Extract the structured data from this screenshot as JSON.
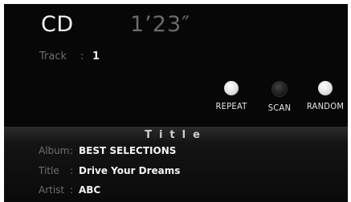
{
  "header": {
    "source": "CD",
    "time": "1’23″"
  },
  "track": {
    "label": "Track",
    "separator": ":",
    "value": "1"
  },
  "modes": [
    {
      "label": "REPEAT",
      "active": false
    },
    {
      "label": "SCAN",
      "active": true
    },
    {
      "label": "RANDOM",
      "active": false
    }
  ],
  "info": {
    "heading": "Title",
    "rows": [
      {
        "label": "Album",
        "separator": ":",
        "value": "BEST SELECTIONS"
      },
      {
        "label": "Title",
        "separator": ":",
        "value": "Drive Your Dreams"
      },
      {
        "label": "Artist",
        "separator": ":",
        "value": "ABC"
      }
    ]
  },
  "colors": {
    "background": "#070707",
    "text": "#f2f2f2",
    "dim_text": "#6e6e6e",
    "led_on": "#1f1f1f",
    "led_off": "#e6e6e6"
  }
}
